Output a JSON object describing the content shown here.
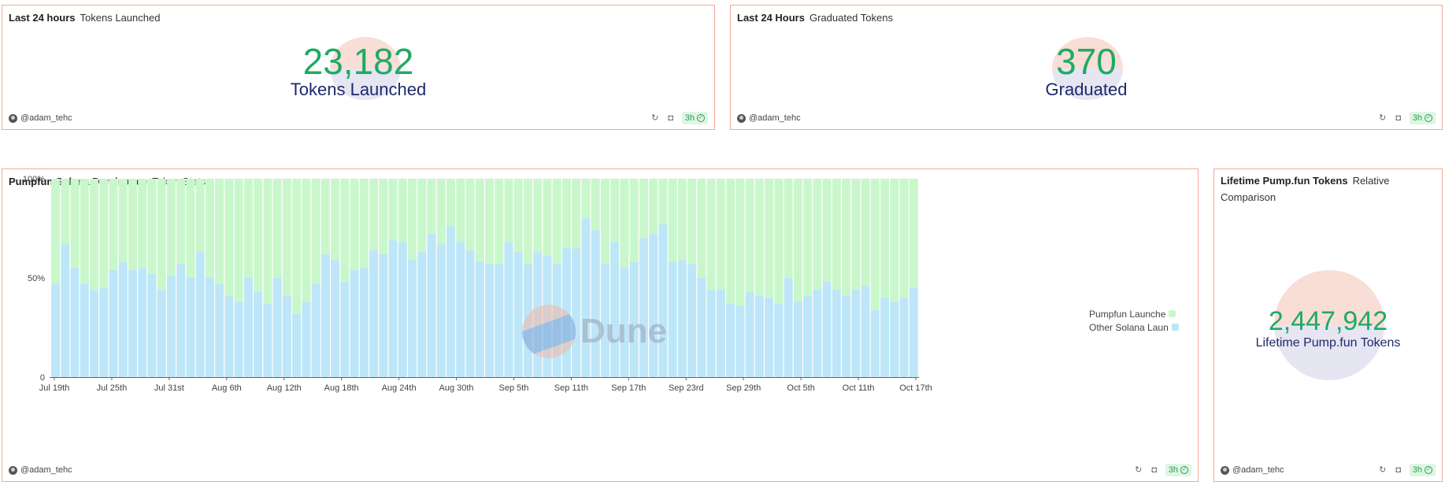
{
  "cards": {
    "tokens_launched": {
      "title_bold": "Last 24 hours",
      "title_sub": "Tokens Launched",
      "value": "23,182",
      "label": "Tokens Launched",
      "author": "@adam_tehc",
      "badge": "3h"
    },
    "graduated": {
      "title_bold": "Last 24 Hours",
      "title_sub": "Graduated Tokens",
      "value": "370",
      "label": "Graduated",
      "author": "@adam_tehc",
      "badge": "3h"
    },
    "dominance": {
      "title_bold": "Pumpfun Solana Dominance",
      "title_sub": "Token Stats",
      "author": "@adam_tehc",
      "badge": "3h",
      "watermark": "Dune"
    },
    "lifetime": {
      "title_bold": "Lifetime Pump.fun Tokens",
      "title_sub": "Relative Comparison",
      "value": "2,447,942",
      "label": "Lifetime Pump.fun Tokens",
      "author": "@adam_tehc",
      "badge": "3h"
    }
  },
  "icons": {
    "refresh": "refresh-icon",
    "camera": "camera-icon",
    "check": "check-circle-icon"
  },
  "colors": {
    "pumpfun": "#c9f7cb",
    "other": "#bde6f8",
    "value_green": "#1fab63",
    "label_navy": "#1d2a6b",
    "card_border": "#f2a994"
  },
  "chart_data": {
    "type": "bar",
    "stacked": "percent",
    "y_ticks": [
      "100%",
      "50%",
      "0"
    ],
    "ylim": [
      0,
      100
    ],
    "x_tick_labels": [
      "Jul 19th",
      "Jul 25th",
      "Jul 31st",
      "Aug 6th",
      "Aug 12th",
      "Aug 18th",
      "Aug 24th",
      "Aug 30th",
      "Sep 5th",
      "Sep 11th",
      "Sep 17th",
      "Sep 23rd",
      "Sep 29th",
      "Oct 5th",
      "Oct 11th",
      "Oct 17th"
    ],
    "x_start": "Jul 19th",
    "x_end": "Oct 17th",
    "series": [
      {
        "name": "Pumpfun Launche",
        "color": "#c9f7cb"
      },
      {
        "name": "Other Solana Laun",
        "color": "#bde6f8"
      }
    ],
    "other_share_pct": [
      47,
      67,
      55,
      47,
      44,
      45,
      54,
      58,
      54,
      55,
      52,
      44,
      51,
      57,
      50,
      63,
      50,
      47,
      41,
      38,
      50,
      43,
      37,
      50,
      41,
      32,
      38,
      47,
      62,
      59,
      48,
      54,
      55,
      64,
      62,
      69,
      68,
      59,
      63,
      72,
      67,
      76,
      68,
      64,
      58,
      57,
      57,
      68,
      63,
      57,
      63,
      61,
      57,
      65,
      65,
      80,
      74,
      57,
      68,
      55,
      58,
      70,
      72,
      77,
      58,
      59,
      57,
      50,
      44,
      44,
      37,
      36,
      43,
      41,
      40,
      37,
      50,
      38,
      41,
      44,
      48,
      44,
      41,
      44,
      46,
      34,
      40,
      38,
      40,
      45
    ],
    "legend_position": "right"
  }
}
